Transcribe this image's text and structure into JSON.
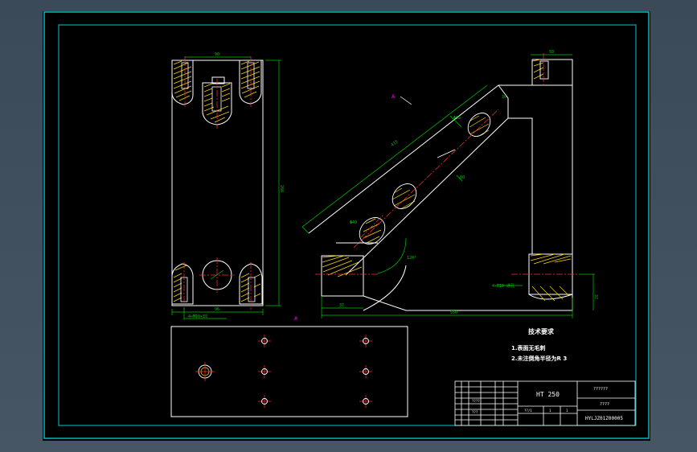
{
  "drawing": {
    "technical_requirements": {
      "title": "技术要求",
      "items": [
        "1.表面无毛刺",
        "2.未注倒角半径为R 3"
      ]
    },
    "title_block": {
      "material": "HT 250",
      "name": "??????",
      "drawing_no": "HYLJZ01Z00005",
      "sub_label": "????",
      "scale_cell": "??/1",
      "sheet_cell_a": "1",
      "sheet_cell_b": "1",
      "sign_a": "????",
      "sign_b": "???"
    },
    "labels": {
      "section_mark": "A",
      "bottom_note": "A",
      "dim_length": "90",
      "dim_width": "96"
    }
  },
  "colors": {
    "workspace": "#3d4d5c",
    "sheet": "#000000",
    "frame": "#00c8c8",
    "geometry": "#ffffff",
    "dimension": "#00c800",
    "hatch": "#ffd700",
    "centerline": "#ff3030",
    "note": "#ff00ff"
  }
}
